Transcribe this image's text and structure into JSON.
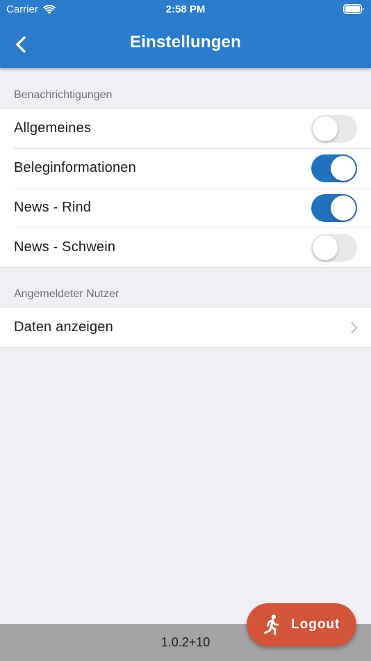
{
  "status_bar": {
    "carrier": "Carrier",
    "time": "2:58 PM",
    "icons": [
      "wifi-icon",
      "battery-icon"
    ]
  },
  "header": {
    "title": "Einstellungen",
    "back_icon": "chevron-left-icon"
  },
  "notifications": {
    "section_title": "Benachrichtigungen",
    "items": [
      {
        "label": "Allgemeines",
        "enabled": false
      },
      {
        "label": "Beleginformationen",
        "enabled": true
      },
      {
        "label": "News - Rind",
        "enabled": true
      },
      {
        "label": "News - Schwein",
        "enabled": false
      }
    ]
  },
  "user": {
    "section_title": "Angemeldeter Nutzer",
    "show_data_label": "Daten anzeigen",
    "chevron_icon": "chevron-right-icon"
  },
  "footer": {
    "version": "1.0.2+10"
  },
  "logout": {
    "label": "Logout",
    "icon": "running-person-icon"
  },
  "colors": {
    "app_bar": "#2b7ccc",
    "toggle_on": "#2272c0",
    "toggle_off": "#e9e9eb",
    "logout": "#d2553a",
    "background": "#efeff4",
    "footer": "#a3a3a3"
  }
}
